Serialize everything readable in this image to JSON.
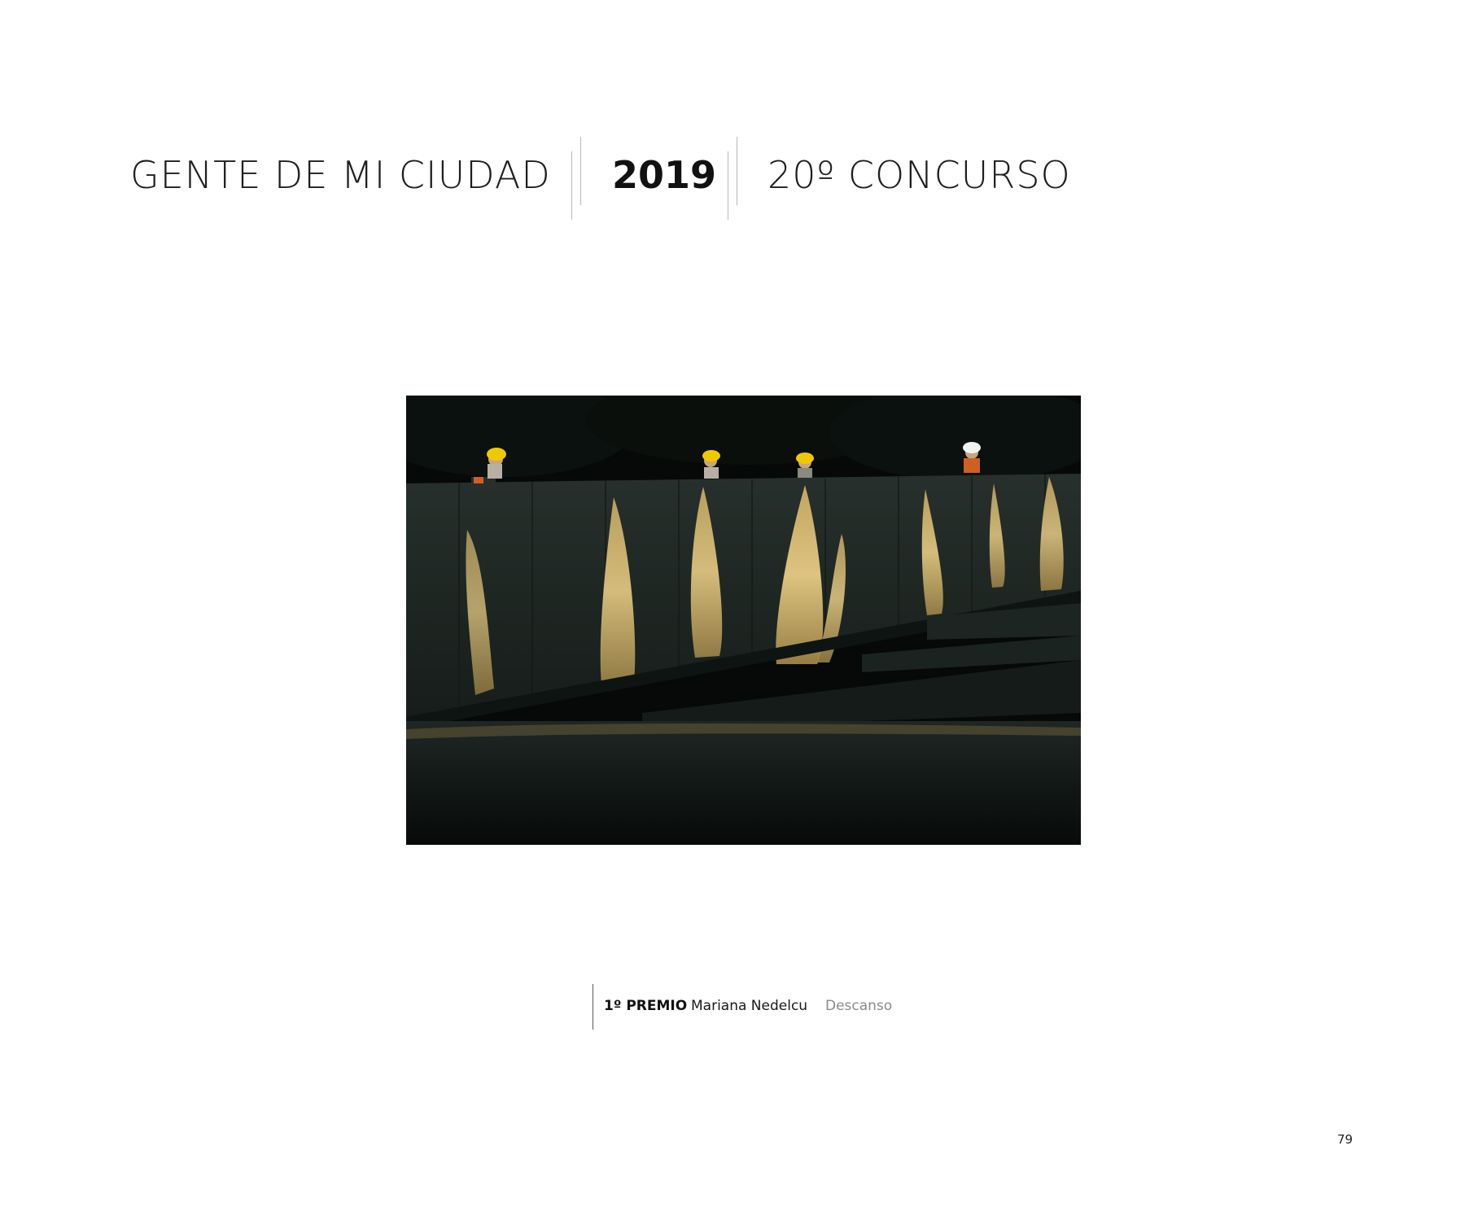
{
  "header": {
    "title": "GENTE DE MI CIUDAD",
    "year": "2019",
    "edition": "20º CONCURSO"
  },
  "caption": {
    "prize": "1º PREMIO",
    "author": "Mariana Nedelcu",
    "work_title": "Descanso"
  },
  "page_number": "79",
  "colors": {
    "text": "#1e1e1e",
    "muted": "#8a8a8a",
    "divider": "#b8b8b8",
    "photo_bg": "#050806",
    "light": "#e3c47a",
    "helmet": "#f0c800"
  }
}
